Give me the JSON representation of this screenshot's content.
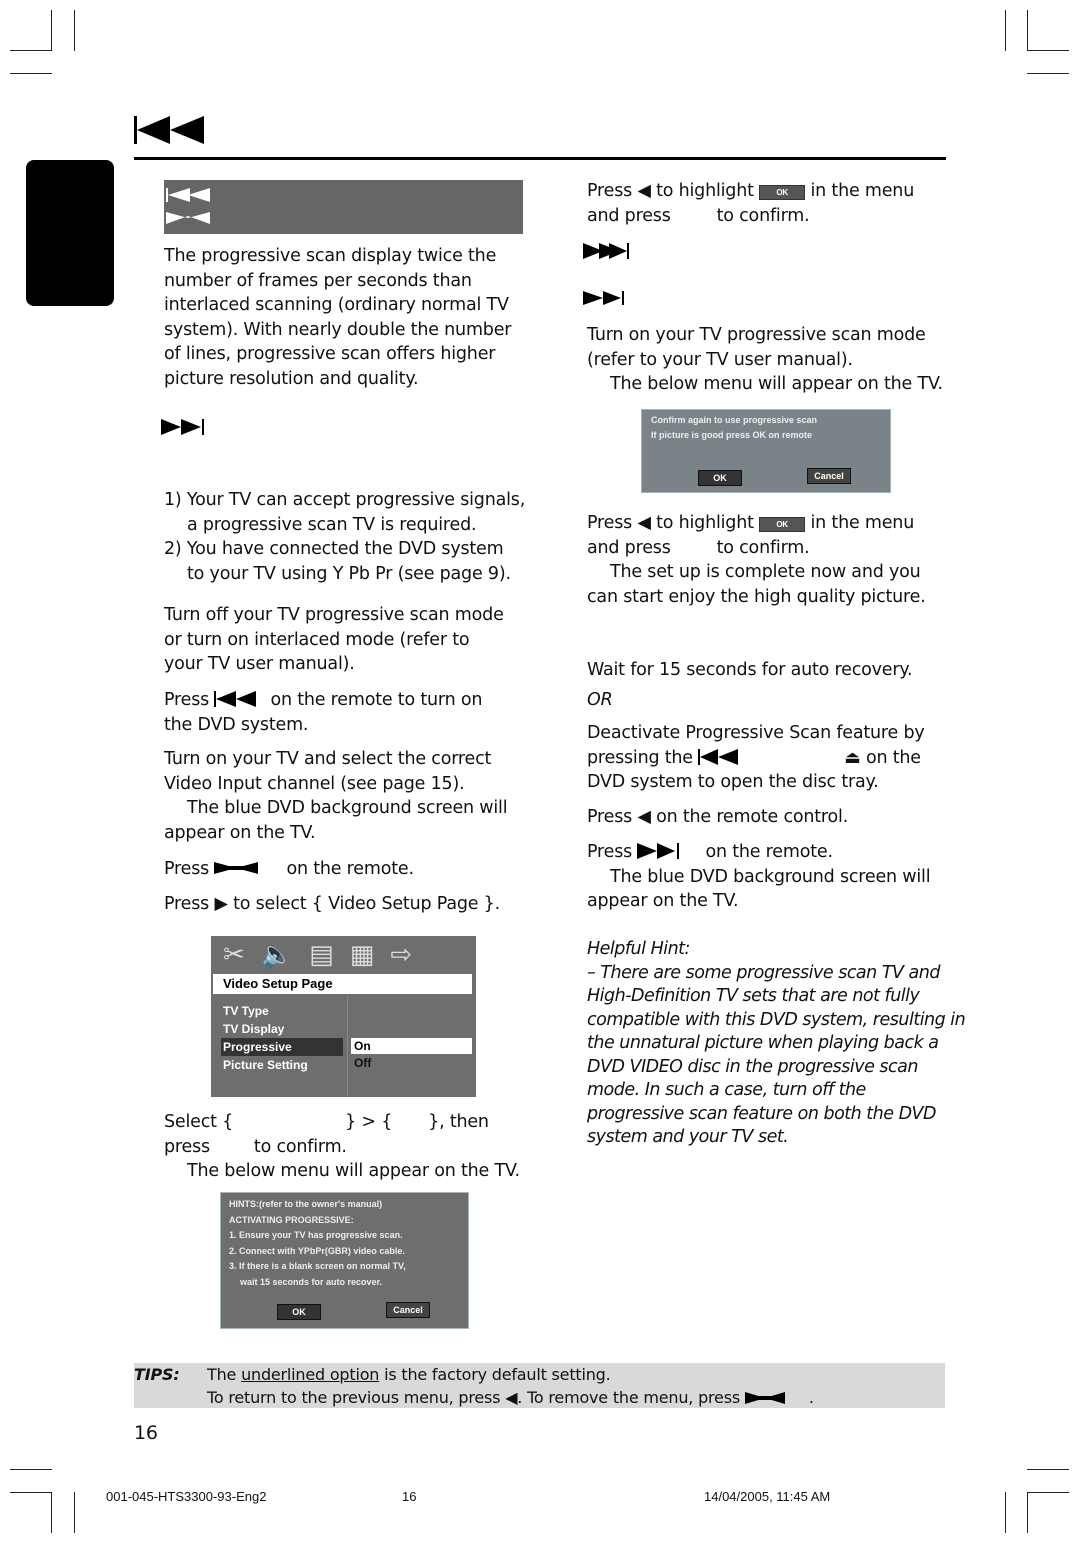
{
  "left": {
    "intro": [
      "The progressive scan display twice the",
      "number of frames per seconds than",
      "interlaced scanning (ordinary normal TV",
      "system). With nearly double the number",
      "of lines, progressive scan offers higher",
      "picture resolution and quality."
    ],
    "req": [
      "1) Your TV can accept progressive signals,",
      "a progressive scan TV is required.",
      "2) You have connected the DVD system",
      "to your TV using Y Pb Pr (see page 9)."
    ],
    "step1": [
      "Turn off your TV progressive scan mode",
      "or turn on interlaced mode (refer to",
      "your TV user manual)."
    ],
    "step2": {
      "a": "Press",
      "b": "on the remote to turn on",
      "c": "the DVD system."
    },
    "step3": [
      "Turn on your TV and select the correct",
      "Video Input channel (see page 15).",
      "The blue DVD background screen will",
      "appear on the TV."
    ],
    "step4": {
      "a": "Press",
      "b": "on the remote."
    },
    "step5": {
      "a": "Press",
      "b": "to select { Video Setup Page }."
    },
    "menu": {
      "title": "Video Setup Page",
      "items": [
        "TV Type",
        "TV Display",
        "Progressive",
        "Picture Setting"
      ],
      "options": [
        "On",
        "Off"
      ]
    },
    "step6": {
      "a": "Select {",
      "b": "} > {",
      "c": "}, then",
      "d": "press",
      "e": "to confirm.",
      "f": "The below menu will appear on the TV."
    },
    "hints": {
      "lines": [
        "HINTS:(refer to the owner's manual)",
        "ACTIVATING PROGRESSIVE:",
        "1. Ensure your TV has progressive scan.",
        "2. Connect with YPbPr(GBR) video cable.",
        "3. If there is a blank screen on normal TV,",
        "wait 15 seconds for auto recover."
      ],
      "ok": "OK",
      "cancel": "Cancel"
    }
  },
  "right": {
    "press1": {
      "a": "Press",
      "b": "to highlight",
      "chip": "OK",
      "c": "in the menu",
      "d": "and press",
      "e": "to confirm."
    },
    "turnon": [
      "Turn on your TV progressive scan mode",
      "(refer to your TV user manual).",
      "The below menu will appear on the TV."
    ],
    "confirm": {
      "lines": [
        "Confirm again to use progressive scan",
        "If picture is good press OK on remote"
      ],
      "ok": "OK",
      "cancel": "Cancel"
    },
    "press2": {
      "a": "Press",
      "b": "to highlight",
      "chip": "OK",
      "c": "in the menu",
      "d": "and press",
      "e": "to confirm.",
      "f": "The set up is complete now and you",
      "g": "can start enjoy the high quality picture."
    },
    "wait": "Wait for 15 seconds for auto recovery.",
    "or": "OR",
    "deact": {
      "a": "Deactivate Progressive Scan feature by",
      "b": "pressing the",
      "c": "⏏ on the",
      "d": "DVD system to open the disc tray."
    },
    "press3": {
      "a": "Press",
      "b": "on the remote control."
    },
    "press4": {
      "a": "Press",
      "b": "on the remote.",
      "c": "The blue DVD background screen will",
      "d": "appear on the TV."
    },
    "hint_title": "Helpful Hint:",
    "hint": [
      "–  There are some progressive scan TV and",
      "High-Definition TV sets that are not fully",
      "compatible with this DVD system, resulting in",
      "the unnatural picture when playing back a",
      "DVD VIDEO disc in the progressive scan",
      "mode.  In such a case, turn off the",
      "progressive scan feature on both the DVD",
      "system and your TV set."
    ]
  },
  "tips": {
    "label": "TIPS:",
    "l1a": "The",
    "l1u": "underlined option",
    "l1b": "is the factory default setting.",
    "l2a": "To return to the previous menu, press ◀.  To remove the menu, press",
    "l2b": "."
  },
  "page_number": "16",
  "footer": {
    "file": "001-045-HTS3300-93-Eng2",
    "page": "16",
    "date": "14/04/2005, 11:45 AM"
  },
  "colors": {
    "section_bar": "#666666",
    "tips_bg": "#d9d9d9",
    "osd_bg": "#6e6e6e",
    "confirm_bg": "#7a8488"
  }
}
